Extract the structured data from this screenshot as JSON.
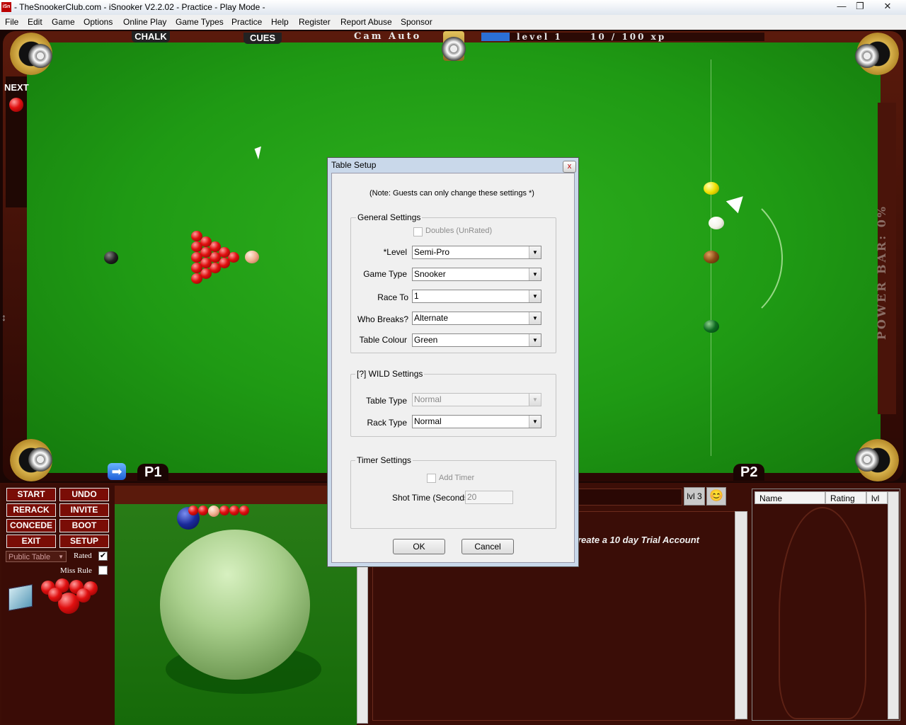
{
  "window": {
    "title": "- TheSnookerClub.com - iSnooker V2.2.02 -  Practice - Play Mode -",
    "app_icon": "iSn",
    "controls": {
      "minimize": "—",
      "maximize": "❐",
      "close": "✕"
    }
  },
  "menu": [
    "File",
    "Edit",
    "Game",
    "Options",
    "Online Play",
    "Game Types",
    "Practice",
    "Help",
    "Register",
    "Report Abuse",
    "Sponsor"
  ],
  "hud": {
    "chalk": "CHALK",
    "cues": "CUES",
    "cam": "Cam Auto",
    "level": "level 1",
    "xp": "10 / 100 xp",
    "xp_progress": 0.1,
    "next": "NEXT",
    "power": "POWER BAR: 0%",
    "p1": "P1",
    "p2": "P2"
  },
  "buttons": {
    "start": "START",
    "undo": "UNDO",
    "rerack": "RERACK",
    "invite": "INVITE",
    "concede": "CONCEDE",
    "boot": "BOOT",
    "exit": "EXIT",
    "setup": "SETUP"
  },
  "table_options": {
    "public_table": "Public Table",
    "rated_label": "Rated",
    "rated_checked": "✔",
    "miss_rule_label": "Miss Rule"
  },
  "chat": {
    "lvl": "lvl 3",
    "smiley": "😊",
    "message": "reate a 10 day Trial Account"
  },
  "players_list": {
    "columns": [
      "Name",
      "Rating",
      "lvl"
    ]
  },
  "dialog": {
    "title": "Table Setup",
    "close": "x",
    "note": "(Note: Guests can only change these settings *)",
    "general": {
      "label": "General Settings",
      "doubles": "Doubles (UnRated)",
      "level_label": "*Level",
      "level_value": "Semi-Pro",
      "game_type_label": "Game Type",
      "game_type_value": "Snooker",
      "race_to_label": "Race To",
      "race_to_value": "1",
      "who_breaks_label": "Who Breaks?",
      "who_breaks_value": "Alternate",
      "table_colour_label": "Table Colour",
      "table_colour_value": "Green"
    },
    "wild": {
      "label": "[?] WILD Settings",
      "table_type_label": "Table Type",
      "table_type_value": "Normal",
      "rack_type_label": "Rack Type",
      "rack_type_value": "Normal"
    },
    "timer": {
      "label": "Timer Settings",
      "add_timer": "Add Timer",
      "shot_time_label": "Shot Time (Seconds)",
      "shot_time_value": "20"
    },
    "ok": "OK",
    "cancel": "Cancel"
  },
  "colors": {
    "felt": "#1f9a14",
    "rail": "#3a0e08",
    "button_red": "#7a0d06",
    "dialog_frame": "#c9d8ea"
  }
}
